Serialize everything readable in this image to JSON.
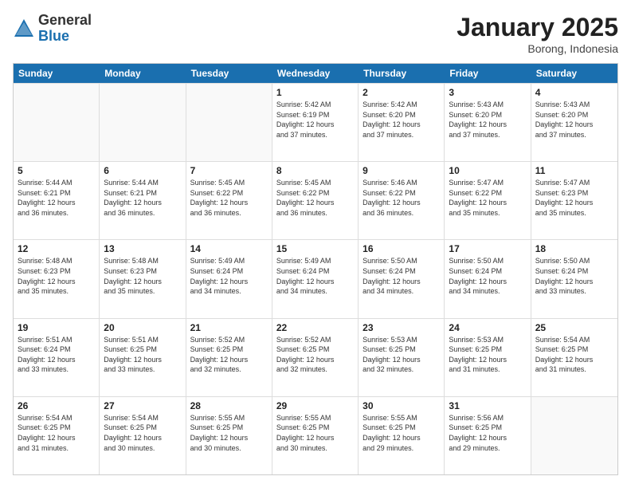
{
  "header": {
    "logo_general": "General",
    "logo_blue": "Blue",
    "month_title": "January 2025",
    "location": "Borong, Indonesia"
  },
  "days_of_week": [
    "Sunday",
    "Monday",
    "Tuesday",
    "Wednesday",
    "Thursday",
    "Friday",
    "Saturday"
  ],
  "weeks": [
    [
      {
        "day": "",
        "text": ""
      },
      {
        "day": "",
        "text": ""
      },
      {
        "day": "",
        "text": ""
      },
      {
        "day": "1",
        "text": "Sunrise: 5:42 AM\nSunset: 6:19 PM\nDaylight: 12 hours\nand 37 minutes."
      },
      {
        "day": "2",
        "text": "Sunrise: 5:42 AM\nSunset: 6:20 PM\nDaylight: 12 hours\nand 37 minutes."
      },
      {
        "day": "3",
        "text": "Sunrise: 5:43 AM\nSunset: 6:20 PM\nDaylight: 12 hours\nand 37 minutes."
      },
      {
        "day": "4",
        "text": "Sunrise: 5:43 AM\nSunset: 6:20 PM\nDaylight: 12 hours\nand 37 minutes."
      }
    ],
    [
      {
        "day": "5",
        "text": "Sunrise: 5:44 AM\nSunset: 6:21 PM\nDaylight: 12 hours\nand 36 minutes."
      },
      {
        "day": "6",
        "text": "Sunrise: 5:44 AM\nSunset: 6:21 PM\nDaylight: 12 hours\nand 36 minutes."
      },
      {
        "day": "7",
        "text": "Sunrise: 5:45 AM\nSunset: 6:22 PM\nDaylight: 12 hours\nand 36 minutes."
      },
      {
        "day": "8",
        "text": "Sunrise: 5:45 AM\nSunset: 6:22 PM\nDaylight: 12 hours\nand 36 minutes."
      },
      {
        "day": "9",
        "text": "Sunrise: 5:46 AM\nSunset: 6:22 PM\nDaylight: 12 hours\nand 36 minutes."
      },
      {
        "day": "10",
        "text": "Sunrise: 5:47 AM\nSunset: 6:22 PM\nDaylight: 12 hours\nand 35 minutes."
      },
      {
        "day": "11",
        "text": "Sunrise: 5:47 AM\nSunset: 6:23 PM\nDaylight: 12 hours\nand 35 minutes."
      }
    ],
    [
      {
        "day": "12",
        "text": "Sunrise: 5:48 AM\nSunset: 6:23 PM\nDaylight: 12 hours\nand 35 minutes."
      },
      {
        "day": "13",
        "text": "Sunrise: 5:48 AM\nSunset: 6:23 PM\nDaylight: 12 hours\nand 35 minutes."
      },
      {
        "day": "14",
        "text": "Sunrise: 5:49 AM\nSunset: 6:24 PM\nDaylight: 12 hours\nand 34 minutes."
      },
      {
        "day": "15",
        "text": "Sunrise: 5:49 AM\nSunset: 6:24 PM\nDaylight: 12 hours\nand 34 minutes."
      },
      {
        "day": "16",
        "text": "Sunrise: 5:50 AM\nSunset: 6:24 PM\nDaylight: 12 hours\nand 34 minutes."
      },
      {
        "day": "17",
        "text": "Sunrise: 5:50 AM\nSunset: 6:24 PM\nDaylight: 12 hours\nand 34 minutes."
      },
      {
        "day": "18",
        "text": "Sunrise: 5:50 AM\nSunset: 6:24 PM\nDaylight: 12 hours\nand 33 minutes."
      }
    ],
    [
      {
        "day": "19",
        "text": "Sunrise: 5:51 AM\nSunset: 6:24 PM\nDaylight: 12 hours\nand 33 minutes."
      },
      {
        "day": "20",
        "text": "Sunrise: 5:51 AM\nSunset: 6:25 PM\nDaylight: 12 hours\nand 33 minutes."
      },
      {
        "day": "21",
        "text": "Sunrise: 5:52 AM\nSunset: 6:25 PM\nDaylight: 12 hours\nand 32 minutes."
      },
      {
        "day": "22",
        "text": "Sunrise: 5:52 AM\nSunset: 6:25 PM\nDaylight: 12 hours\nand 32 minutes."
      },
      {
        "day": "23",
        "text": "Sunrise: 5:53 AM\nSunset: 6:25 PM\nDaylight: 12 hours\nand 32 minutes."
      },
      {
        "day": "24",
        "text": "Sunrise: 5:53 AM\nSunset: 6:25 PM\nDaylight: 12 hours\nand 31 minutes."
      },
      {
        "day": "25",
        "text": "Sunrise: 5:54 AM\nSunset: 6:25 PM\nDaylight: 12 hours\nand 31 minutes."
      }
    ],
    [
      {
        "day": "26",
        "text": "Sunrise: 5:54 AM\nSunset: 6:25 PM\nDaylight: 12 hours\nand 31 minutes."
      },
      {
        "day": "27",
        "text": "Sunrise: 5:54 AM\nSunset: 6:25 PM\nDaylight: 12 hours\nand 30 minutes."
      },
      {
        "day": "28",
        "text": "Sunrise: 5:55 AM\nSunset: 6:25 PM\nDaylight: 12 hours\nand 30 minutes."
      },
      {
        "day": "29",
        "text": "Sunrise: 5:55 AM\nSunset: 6:25 PM\nDaylight: 12 hours\nand 30 minutes."
      },
      {
        "day": "30",
        "text": "Sunrise: 5:55 AM\nSunset: 6:25 PM\nDaylight: 12 hours\nand 29 minutes."
      },
      {
        "day": "31",
        "text": "Sunrise: 5:56 AM\nSunset: 6:25 PM\nDaylight: 12 hours\nand 29 minutes."
      },
      {
        "day": "",
        "text": ""
      }
    ]
  ]
}
